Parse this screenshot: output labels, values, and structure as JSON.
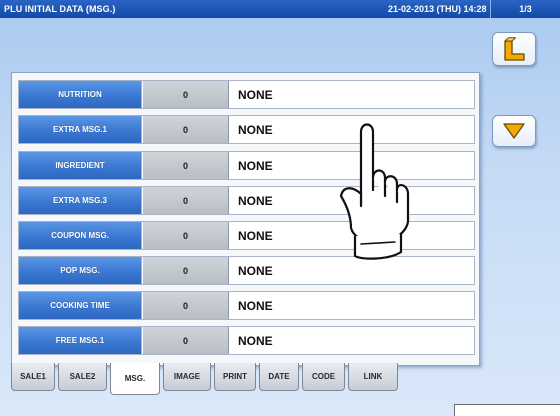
{
  "titlebar": {
    "title": "PLU INITIAL DATA (MSG.)",
    "datetime": "21-02-2013 (THU) 14:28",
    "page": "1/3"
  },
  "rows": [
    {
      "label": "NUTRITION",
      "number": "0",
      "value": "NONE"
    },
    {
      "label": "EXTRA MSG.1",
      "number": "0",
      "value": "NONE"
    },
    {
      "label": "INGREDIENT",
      "number": "0",
      "value": "NONE"
    },
    {
      "label": "EXTRA MSG.3",
      "number": "0",
      "value": "NONE"
    },
    {
      "label": "COUPON MSG.",
      "number": "0",
      "value": "NONE"
    },
    {
      "label": "POP MSG.",
      "number": "0",
      "value": "NONE"
    },
    {
      "label": "COOKING TIME",
      "number": "0",
      "value": "NONE"
    },
    {
      "label": "FREE MSG.1",
      "number": "0",
      "value": "NONE"
    }
  ],
  "tabs": [
    "SALE1",
    "SALE2",
    "MSG.",
    "IMAGE",
    "PRINT",
    "DATE",
    "CODE",
    "LINK"
  ],
  "active_tab": "MSG.",
  "icons": {
    "back": "return-arrow-icon",
    "down": "down-triangle-icon",
    "pointer": "pointing-hand-icon"
  },
  "colors": {
    "titlebar": "#124aa6",
    "label_button": "#3a78d2",
    "arrow_orange": "#f2a900"
  }
}
